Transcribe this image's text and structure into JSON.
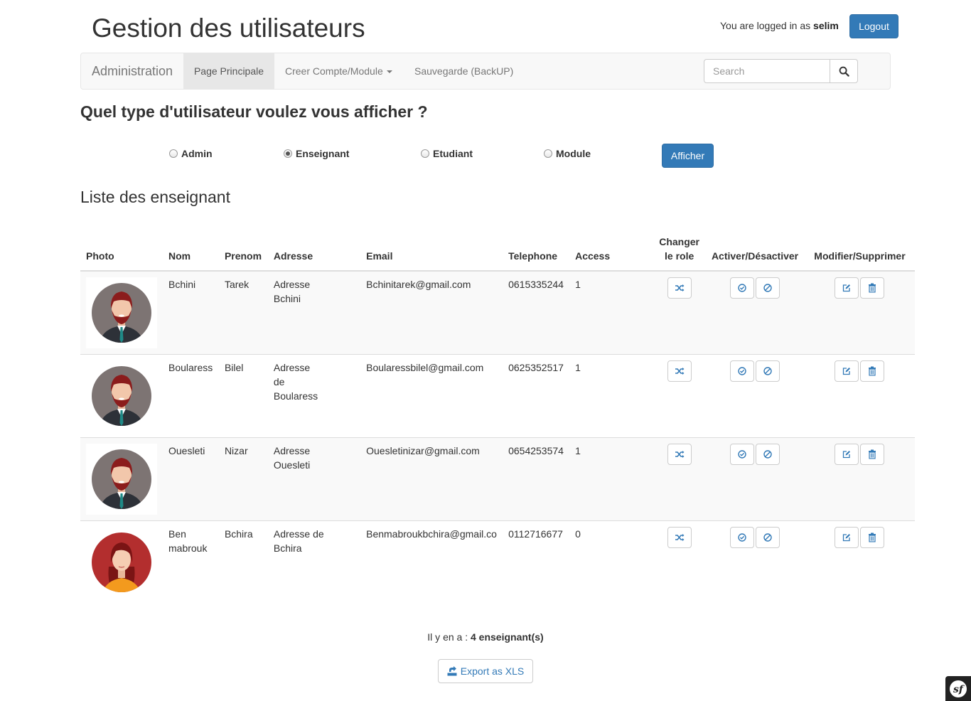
{
  "header": {
    "title": "Gestion des utilisateurs",
    "login_prefix": "You are logged in as",
    "username": "selim",
    "logout_label": "Logout"
  },
  "navbar": {
    "brand": "Administration",
    "items": [
      {
        "label": "Page Principale",
        "active": true
      },
      {
        "label": "Creer Compte/Module",
        "dropdown": true
      },
      {
        "label": "Sauvegarde (BackUP)"
      }
    ],
    "search_placeholder": "Search"
  },
  "filter": {
    "question": "Quel type d'utilisateur voulez vous afficher ?",
    "options": [
      {
        "label": "Admin",
        "checked": false
      },
      {
        "label": "Enseignant",
        "checked": true
      },
      {
        "label": "Etudiant",
        "checked": false
      },
      {
        "label": "Module",
        "checked": false
      }
    ],
    "submit_label": "Afficher"
  },
  "list": {
    "title": "Liste des enseignant",
    "columns": [
      "Photo",
      "Nom",
      "Prenom",
      "Adresse",
      "Email",
      "Telephone",
      "Access",
      "Changer le role",
      "Activer/Désactiver",
      "Modifier/Supprimer"
    ],
    "rows": [
      {
        "avatar": "male-avatar",
        "nom": "Bchini",
        "prenom": "Tarek",
        "adresse": "Adresse Bchini",
        "email": "Bchinitarek@gmail.com",
        "telephone": "0615335244",
        "access": "1"
      },
      {
        "avatar": "male-avatar",
        "nom": "Boularess",
        "prenom": "Bilel",
        "adresse": "Adresse de Boularess",
        "email": "Boularessbilel@gmail.com",
        "telephone": "0625352517",
        "access": "1"
      },
      {
        "avatar": "male-avatar",
        "nom": "Ouesleti",
        "prenom": "Nizar",
        "adresse": "Adresse Ouesleti",
        "email": "Ouesletinizar@gmail.com",
        "telephone": "0654253574",
        "access": "1"
      },
      {
        "avatar": "female-avatar",
        "nom": "Ben mabrouk",
        "prenom": "Bchira",
        "adresse": "Adresse de Bchira",
        "email": "Benmabroukbchira@gmail.co",
        "telephone": "0112716677",
        "access": "0"
      }
    ]
  },
  "footer": {
    "count_prefix": "Il y en a :",
    "count_value": "4 enseignant(s)",
    "export_label": "Export as XLS"
  },
  "colors": {
    "primary": "#337ab7",
    "navbar_bg": "#f8f8f8",
    "stripe_bg": "#f9f9f9"
  }
}
